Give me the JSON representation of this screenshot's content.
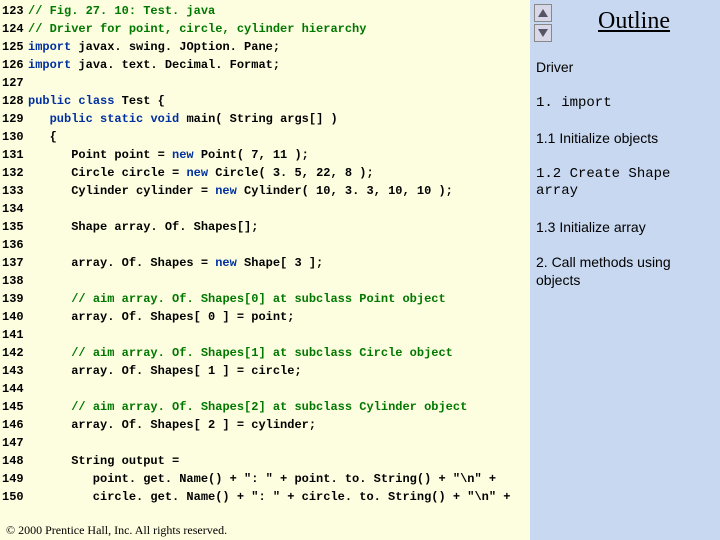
{
  "outline": {
    "title": "Outline",
    "notes": [
      {
        "text": "Driver",
        "mono": false
      },
      {
        "text": "1. import",
        "mono": true
      },
      {
        "text": "1.1 Initialize objects",
        "mono": false
      },
      {
        "text": "1.2 Create Shape array",
        "mono": true
      },
      {
        "text": "1.3 Initialize array",
        "mono": false
      },
      {
        "text": "2. Call methods using objects",
        "mono": false
      }
    ]
  },
  "footer": "© 2000 Prentice Hall, Inc.  All rights reserved.",
  "code": [
    {
      "n": "123",
      "segs": [
        {
          "t": "// Fig. 27. 10: Test. java",
          "c": "cm"
        }
      ]
    },
    {
      "n": "124",
      "segs": [
        {
          "t": "// Driver for point, circle, cylinder hierarchy",
          "c": "cm"
        }
      ]
    },
    {
      "n": "125",
      "segs": [
        {
          "t": "import",
          "c": "kw"
        },
        {
          "t": " javax. swing. JOption. Pane;",
          "c": "pl"
        }
      ]
    },
    {
      "n": "126",
      "segs": [
        {
          "t": "import",
          "c": "kw"
        },
        {
          "t": " java. text. Decimal. Format;",
          "c": "pl"
        }
      ]
    },
    {
      "n": "127",
      "segs": [
        {
          "t": "",
          "c": "pl"
        }
      ]
    },
    {
      "n": "128",
      "segs": [
        {
          "t": "public",
          "c": "kw"
        },
        {
          "t": " ",
          "c": "pl"
        },
        {
          "t": "class",
          "c": "kw"
        },
        {
          "t": " Test {",
          "c": "pl"
        }
      ]
    },
    {
      "n": "129",
      "segs": [
        {
          "t": "   ",
          "c": "pl"
        },
        {
          "t": "public",
          "c": "kw"
        },
        {
          "t": " ",
          "c": "pl"
        },
        {
          "t": "static",
          "c": "kw"
        },
        {
          "t": " ",
          "c": "pl"
        },
        {
          "t": "void",
          "c": "kw"
        },
        {
          "t": " main( String args[] )",
          "c": "pl"
        }
      ]
    },
    {
      "n": "130",
      "segs": [
        {
          "t": "   {",
          "c": "pl"
        }
      ]
    },
    {
      "n": "131",
      "segs": [
        {
          "t": "      Point point = ",
          "c": "pl"
        },
        {
          "t": "new",
          "c": "kw"
        },
        {
          "t": " Point( 7, 11 );",
          "c": "pl"
        }
      ]
    },
    {
      "n": "132",
      "segs": [
        {
          "t": "      Circle circle = ",
          "c": "pl"
        },
        {
          "t": "new",
          "c": "kw"
        },
        {
          "t": " Circle( 3. 5, 22, 8 );",
          "c": "pl"
        }
      ]
    },
    {
      "n": "133",
      "segs": [
        {
          "t": "      Cylinder cylinder = ",
          "c": "pl"
        },
        {
          "t": "new",
          "c": "kw"
        },
        {
          "t": " Cylinder( 10, 3. 3, 10, 10 );",
          "c": "pl"
        }
      ]
    },
    {
      "n": "134",
      "segs": [
        {
          "t": "",
          "c": "pl"
        }
      ]
    },
    {
      "n": "135",
      "segs": [
        {
          "t": "      Shape array. Of. Shapes[];",
          "c": "pl"
        }
      ]
    },
    {
      "n": "136",
      "segs": [
        {
          "t": "",
          "c": "pl"
        }
      ]
    },
    {
      "n": "137",
      "segs": [
        {
          "t": "      array. Of. Shapes = ",
          "c": "pl"
        },
        {
          "t": "new",
          "c": "kw"
        },
        {
          "t": " Shape[ 3 ];",
          "c": "pl"
        }
      ]
    },
    {
      "n": "138",
      "segs": [
        {
          "t": "",
          "c": "pl"
        }
      ]
    },
    {
      "n": "139",
      "segs": [
        {
          "t": "      ",
          "c": "pl"
        },
        {
          "t": "// aim array. Of. Shapes[0] at subclass Point object",
          "c": "cm"
        }
      ]
    },
    {
      "n": "140",
      "segs": [
        {
          "t": "      array. Of. Shapes[ 0 ] = point;",
          "c": "pl"
        }
      ]
    },
    {
      "n": "141",
      "segs": [
        {
          "t": "",
          "c": "pl"
        }
      ]
    },
    {
      "n": "142",
      "segs": [
        {
          "t": "      ",
          "c": "pl"
        },
        {
          "t": "// aim array. Of. Shapes[1] at subclass Circle object",
          "c": "cm"
        }
      ]
    },
    {
      "n": "143",
      "segs": [
        {
          "t": "      array. Of. Shapes[ 1 ] = circle;",
          "c": "pl"
        }
      ]
    },
    {
      "n": "144",
      "segs": [
        {
          "t": "",
          "c": "pl"
        }
      ]
    },
    {
      "n": "145",
      "segs": [
        {
          "t": "      ",
          "c": "pl"
        },
        {
          "t": "// aim array. Of. Shapes[2] at subclass Cylinder object",
          "c": "cm"
        }
      ]
    },
    {
      "n": "146",
      "segs": [
        {
          "t": "      array. Of. Shapes[ 2 ] = cylinder;",
          "c": "pl"
        }
      ]
    },
    {
      "n": "147",
      "segs": [
        {
          "t": "",
          "c": "pl"
        }
      ]
    },
    {
      "n": "148",
      "segs": [
        {
          "t": "      String output =",
          "c": "pl"
        }
      ]
    },
    {
      "n": "149",
      "segs": [
        {
          "t": "         point. get. Name() + \": \" + point. to. String() + \"\\n\" +",
          "c": "pl"
        }
      ]
    },
    {
      "n": "150",
      "segs": [
        {
          "t": "         circle. get. Name() + \": \" + circle. to. String() + \"\\n\" +",
          "c": "pl"
        }
      ]
    }
  ]
}
